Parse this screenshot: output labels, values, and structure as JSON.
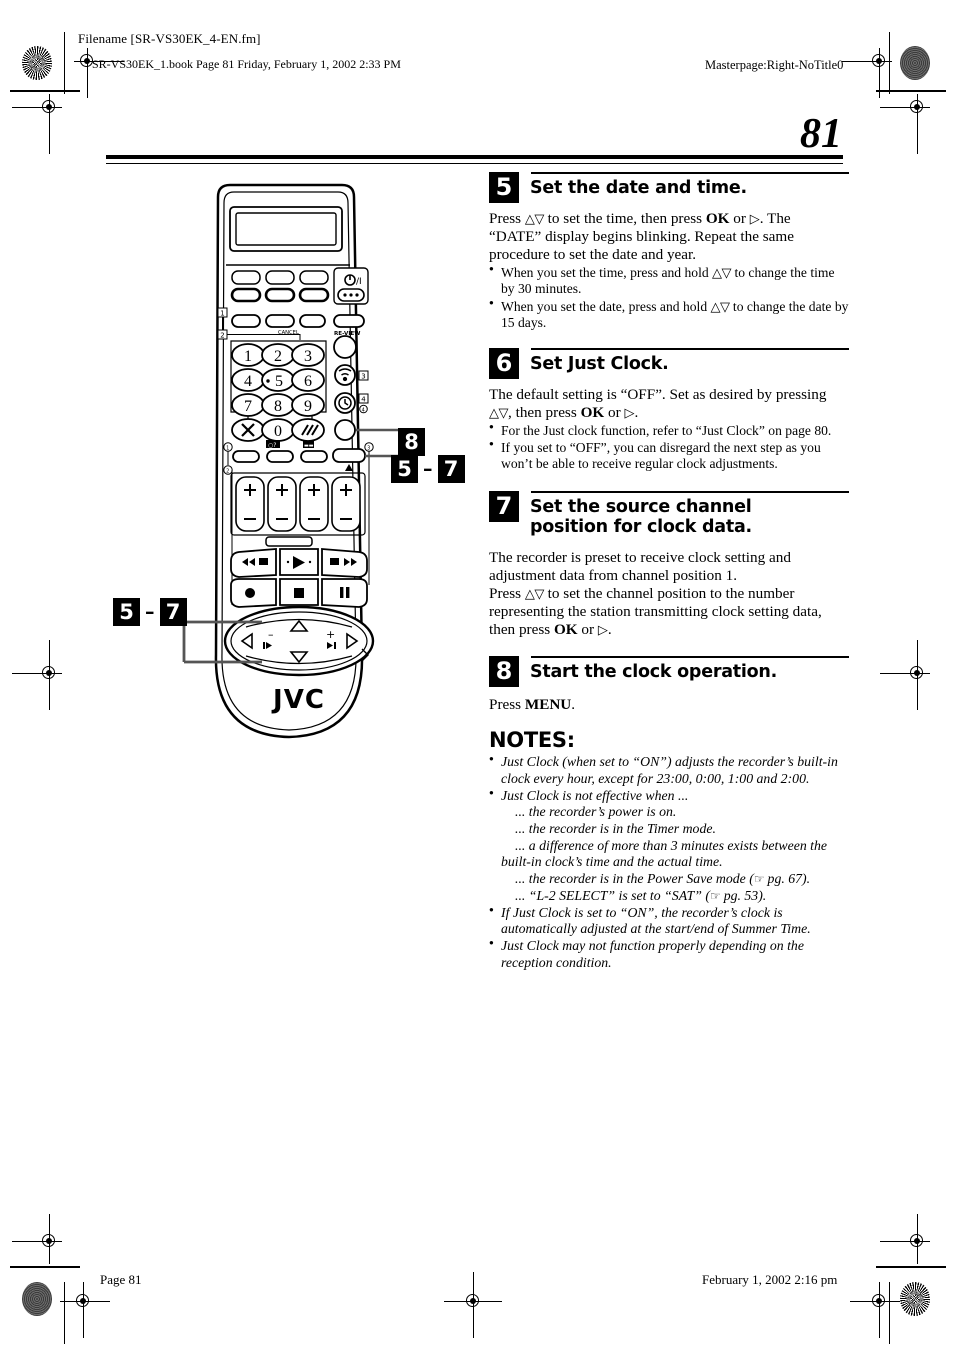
{
  "page": {
    "number": "81",
    "header": {
      "filename": "[Filename [SR-VS30EK_4-EN.fm]",
      "filename_display": "Filename [SR-VS30EK_4-EN.fm]",
      "bookline": "SR-VS30EK_1.book  Page 81  Friday, February 1, 2002  2:33 PM",
      "masterpage": "Masterpage:Right-NoTitle0"
    },
    "footer": {
      "left": "Page 81",
      "right": "February 1, 2002 2:16 pm"
    }
  },
  "steps": [
    {
      "num": "5",
      "title": "Set the date and time.",
      "body_lines": [
        "Press △▽ to set the time, then press OK or ▷. The",
        "“DATE” display begins blinking. Repeat the same",
        "procedure to set the date and year."
      ],
      "bullets": [
        "When you set the time, press and hold △▽ to change the time by 30 minutes.",
        "When you set the date, press and hold △▽ to change the date by 15 days."
      ]
    },
    {
      "num": "6",
      "title": "Set Just Clock.",
      "body_lines": [
        "The default setting is “OFF”. Set as desired by pressing",
        "△▽, then press OK or ▷."
      ],
      "bullets": [
        "For the Just clock function, refer to “Just Clock” on page 80.",
        "If you set to “OFF”, you can disregard the next step as you won’t be able to receive regular clock adjustments."
      ]
    },
    {
      "num": "7",
      "title": "Set the source channel position for clock data.",
      "body_lines": [
        "The recorder is preset to receive clock setting and",
        "adjustment data from channel position 1.",
        "Press △▽ to set the channel position to the number",
        "representing the station transmitting clock setting data,",
        "then press OK or ▷."
      ],
      "bullets": []
    },
    {
      "num": "8",
      "title": "Start the clock operation.",
      "body_lines": [
        "Press MENU."
      ],
      "bullets": []
    }
  ],
  "notes": {
    "heading": "NOTES:",
    "items": [
      {
        "text": "Just Clock (when set to “ON”) adjusts the recorder’s built-in clock every hour, except for 23:00, 0:00, 1:00 and 2:00.",
        "subs": []
      },
      {
        "text": "Just Clock is not effective when ...",
        "subs": [
          "... the recorder’s power is on.",
          "... the recorder is in the Timer mode.",
          "... a difference of more than 3 minutes exists between the built-in clock’s time and the actual time.",
          "... the recorder is in the Power Save mode (☞ pg. 67).",
          "... “L-2 SELECT” is set to “SAT” (☞ pg. 53)."
        ]
      },
      {
        "text": "If Just Clock is set to “ON”, the recorder’s clock is automatically adjusted at the start/end of Summer Time.",
        "subs": []
      },
      {
        "text": "Just Clock may not function properly depending on the reception condition.",
        "subs": []
      }
    ]
  },
  "illustration": {
    "brand": "JVC",
    "keypad": [
      "1",
      "2",
      "3",
      "4",
      "5",
      "6",
      "7",
      "8",
      "9",
      "0"
    ],
    "labels": {
      "power": "⏻/I",
      "cancel": "CANCEL",
      "review": "RE-VIEW"
    },
    "markers": [
      "1",
      "2",
      "3",
      "4"
    ],
    "callouts": [
      {
        "id": "callout-8",
        "text": "8"
      },
      {
        "id": "callout-5-7-top",
        "from": "5",
        "dash": "–",
        "to": "7"
      },
      {
        "id": "callout-5-7-bottom",
        "from": "5",
        "dash": "–",
        "to": "7"
      }
    ]
  }
}
